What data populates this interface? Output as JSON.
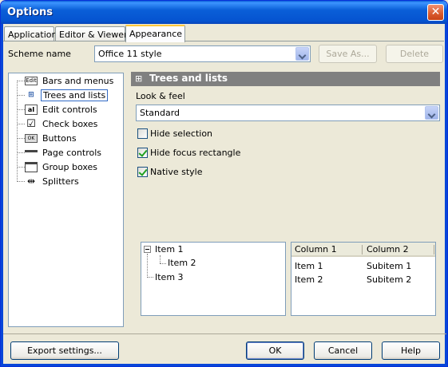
{
  "window": {
    "title": "Options"
  },
  "tabs": [
    {
      "label": "Application"
    },
    {
      "label": "Editor & Viewers"
    },
    {
      "label": "Appearance"
    }
  ],
  "scheme": {
    "label": "Scheme name",
    "value": "Office 11 style",
    "save_as": "Save As...",
    "delete": "Delete"
  },
  "tree": {
    "items": [
      {
        "label": "Bars and menus",
        "icon": "menu-bar-icon"
      },
      {
        "label": "Trees and lists",
        "icon": "tree-icon"
      },
      {
        "label": "Edit controls",
        "icon": "edit-control-icon"
      },
      {
        "label": "Check boxes",
        "icon": "checkbox-icon"
      },
      {
        "label": "Buttons",
        "icon": "button-icon"
      },
      {
        "label": "Page controls",
        "icon": "page-control-icon"
      },
      {
        "label": "Group boxes",
        "icon": "group-box-icon"
      },
      {
        "label": "Splitters",
        "icon": "splitter-icon"
      }
    ],
    "selected": "Trees and lists"
  },
  "section": {
    "title": "Trees and lists",
    "look_label": "Look & feel",
    "look_value": "Standard",
    "checkboxes": [
      {
        "label": "Hide selection",
        "checked": false
      },
      {
        "label": "Hide focus rectangle",
        "checked": true
      },
      {
        "label": "Native style",
        "checked": true
      }
    ]
  },
  "preview_tree": {
    "items": [
      "Item 1",
      "Item 2",
      "Item 3"
    ]
  },
  "preview_list": {
    "columns": [
      "Column 1",
      "Column 2"
    ],
    "rows": [
      [
        "Item 1",
        "Subitem 1"
      ],
      [
        "Item 2",
        "Subitem 2"
      ]
    ]
  },
  "buttons": {
    "export": "Export settings...",
    "ok": "OK",
    "cancel": "Cancel",
    "help": "Help"
  }
}
